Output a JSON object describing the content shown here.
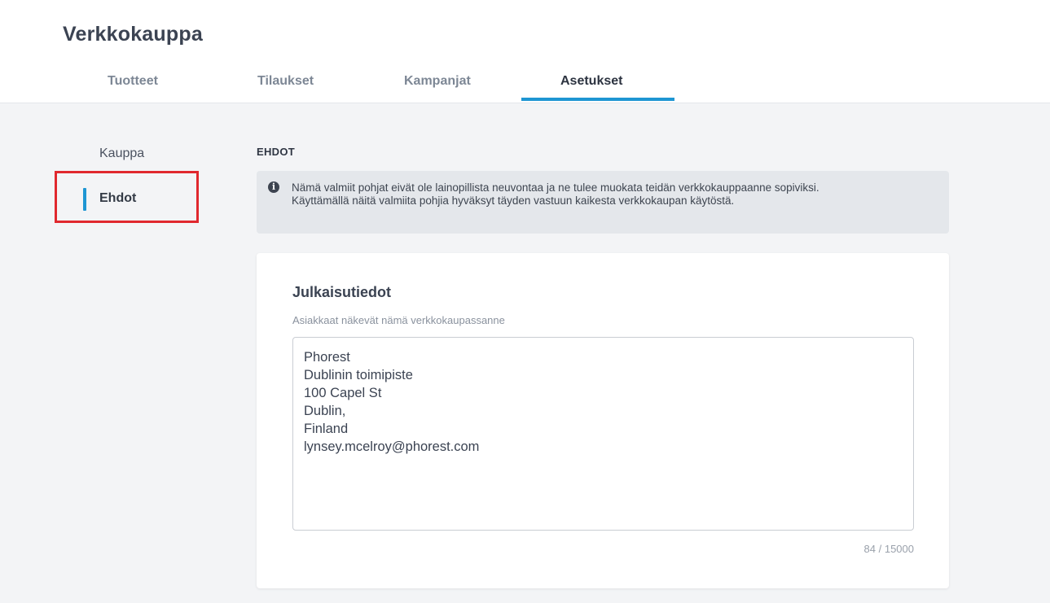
{
  "app": {
    "title": "Verkkokauppa"
  },
  "tabs": [
    {
      "label": "Tuotteet",
      "active": false
    },
    {
      "label": "Tilaukset",
      "active": false
    },
    {
      "label": "Kampanjat",
      "active": false
    },
    {
      "label": "Asetukset",
      "active": true
    }
  ],
  "sidebar": {
    "items": [
      {
        "label": "Kauppa",
        "active": false
      },
      {
        "label": "Ehdot",
        "active": true
      }
    ]
  },
  "section": {
    "title": "EHDOT"
  },
  "notice": {
    "icon": "info-icon",
    "line1": "Nämä valmiit pohjat eivät ole lainopillista neuvontaa ja ne tulee muokata teidän verkkokauppaanne sopiviksi.",
    "line2": "Käyttämällä näitä valmiita pohjia hyväksyt täyden vastuun kaikesta verkkokaupan käytöstä."
  },
  "card": {
    "title": "Julkaisutiedot",
    "subtitle": "Asiakkaat näkevät nämä verkkokaupassanne",
    "textarea_value": "Phorest\nDublinin toimipiste\n100 Capel St\nDublin,\nFinland\nlynsey.mcelroy@phorest.com",
    "counter": "84 / 15000"
  },
  "colors": {
    "accent": "#1e96d3",
    "highlight": "#e0282e",
    "background": "#f3f4f6"
  }
}
